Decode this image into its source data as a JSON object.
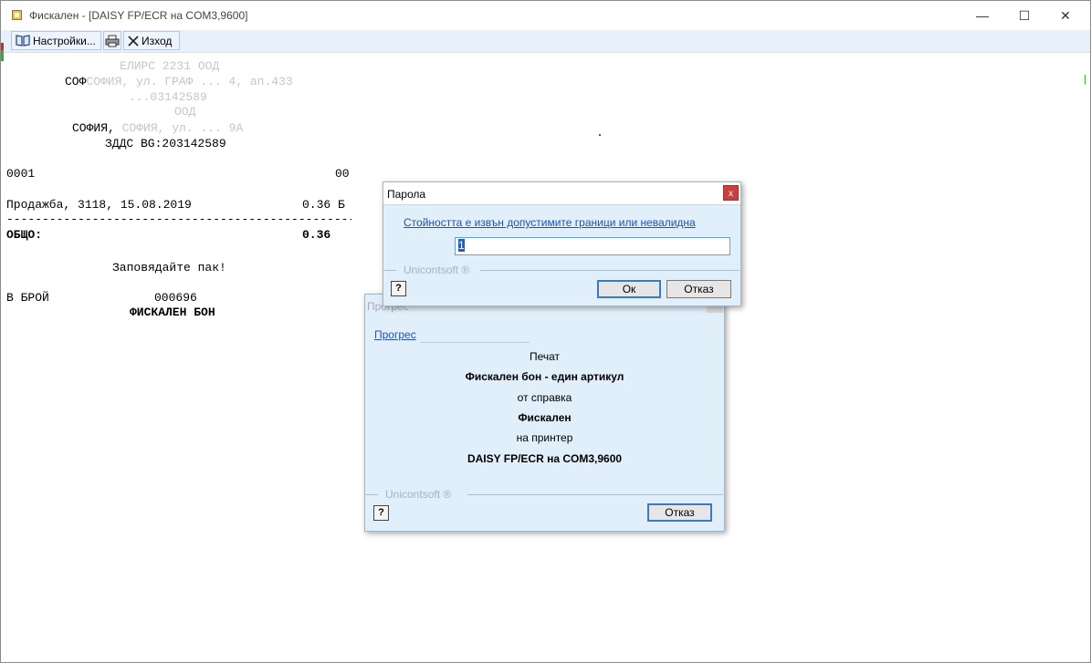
{
  "window": {
    "title": "Фискален - [DAISY FP/ECR на COM3,9600]",
    "min_icon": "—",
    "max_icon": "☐",
    "close_icon": "✕"
  },
  "toolbar": {
    "settings_label": "Настройки...",
    "settings_icon": "book-icon",
    "print_icon": "printer-icon",
    "exit_label": "Изход",
    "exit_icon": "x-icon"
  },
  "receipt": {
    "faint_lines": [
      "ЕЛИРС 2231 ООД",
      "СОФИЯ, ул. ГРАФ ... 4, ап.433",
      "...03142589",
      "ООД",
      "СОФИЯ, ул. ... 9А"
    ],
    "vat_line": "ЗДДС BG:203142589",
    "code_left": "0001",
    "code_right": "00",
    "sale_line": "Продажба, 3118, 15.08.2019",
    "sale_amount": "0.36 Б",
    "divider": "-------------------------------------------------",
    "total_label": "ОБЩО:",
    "total_amount": "0.36",
    "welcome": "Заповядайте пак!",
    "cash_label": "В БРОЙ",
    "cash_number": "000696",
    "fiscal_label": "ФИСКАЛЕН БОН"
  },
  "password_dialog": {
    "title": "Парола",
    "close_label": "x",
    "message": "Стойността е извън допустимите граници или невалидна парола за оператор",
    "input_value": "1",
    "brand": "Unicontsoft ®",
    "ok_label": "Ок",
    "cancel_label": "Отказ",
    "help_label": "?"
  },
  "progress_dialog": {
    "title": "Прогрес",
    "link": "Прогрес",
    "lines": [
      "Печат",
      "Фискален бон - един артикул",
      "от справка",
      "Фискален",
      "на принтер",
      "DAISY FP/ECR на COM3,9600"
    ],
    "brand": "Unicontsoft ®",
    "cancel_label": "Отказ",
    "help_label": "?"
  }
}
